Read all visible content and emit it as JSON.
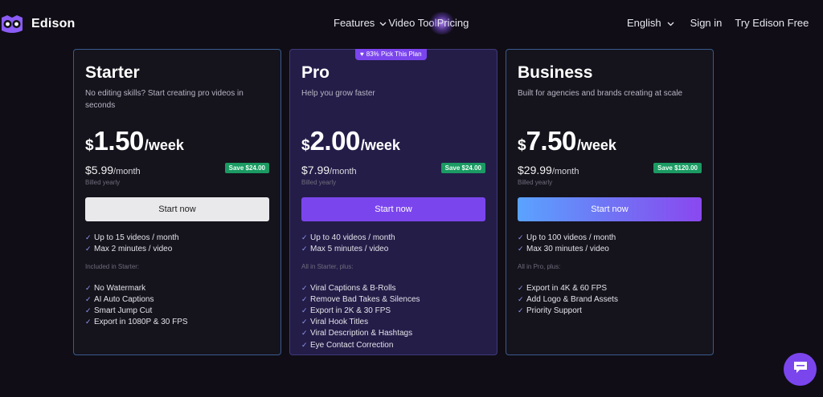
{
  "brand": {
    "name": "Edison",
    "accent": "#7b45ee"
  },
  "nav": {
    "features": "Features",
    "video_tool": "Video Tool",
    "pricing": "Pricing",
    "language": "English",
    "sign_in": "Sign in",
    "try_free": "Try Edison Free"
  },
  "plans": [
    {
      "name": "Starter",
      "subtitle": "No editing skills? Start creating pro videos in seconds",
      "currency": "$",
      "price": "1.50",
      "per": "/week",
      "monthly": "$5.99",
      "monthly_unit": "/month",
      "save": "Save $24.00",
      "billed": "Billed yearly",
      "cta": "Start now",
      "limits": [
        "Up to 15 videos / month",
        "Max 2 minutes / video"
      ],
      "included_heading": "Included in Starter:",
      "features": [
        "No Watermark",
        "AI Auto Captions",
        "Smart Jump Cut",
        "Export in 1080P & 30 FPS"
      ]
    },
    {
      "name": "Pro",
      "badge": "83% Pick This Plan",
      "subtitle": "Help you grow faster",
      "currency": "$",
      "price": "2.00",
      "per": "/week",
      "monthly": "$7.99",
      "monthly_unit": "/month",
      "save": "Save $24.00",
      "billed": "Billed yearly",
      "cta": "Start now",
      "limits": [
        "Up to 40 videos / month",
        "Max 5 minutes / video"
      ],
      "included_heading": "All in Starter, plus:",
      "features": [
        "Viral Captions & B-Rolls",
        "Remove Bad Takes & Silences",
        "Export in 2K & 30 FPS",
        "Viral Hook Titles",
        "Viral Description & Hashtags",
        "Eye Contact Correction"
      ]
    },
    {
      "name": "Business",
      "subtitle": "Built for agencies and brands creating at scale",
      "currency": "$",
      "price": "7.50",
      "per": "/week",
      "monthly": "$29.99",
      "monthly_unit": "/month",
      "save": "Save $120.00",
      "billed": "Billed yearly",
      "cta": "Start now",
      "limits": [
        "Up to 100 videos / month",
        "Max 30 minutes / video"
      ],
      "included_heading": "All in Pro, plus:",
      "features": [
        "Export in 4K & 60 FPS",
        "Add Logo & Brand Assets",
        "Priority Support"
      ]
    }
  ]
}
